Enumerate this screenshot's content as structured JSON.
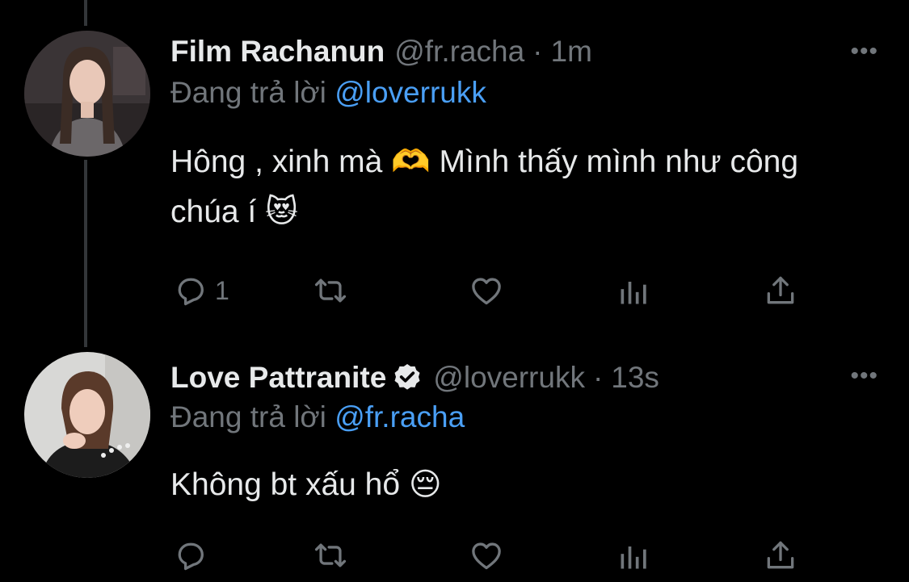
{
  "tweets": [
    {
      "name": "Film Rachanun",
      "handle": "@fr.racha",
      "sep": "·",
      "time": "1m",
      "reply_prefix": "Đang trả lời",
      "reply_to": "@loverrukk",
      "text_line1": "Hông , xinh mà 🫶  Mình thấy mình như công",
      "text_line2": "chúa í 😻",
      "reply_count": "1",
      "more": "•••"
    },
    {
      "name": "Love Pattranite",
      "handle": "@loverrukk",
      "sep": "·",
      "time": "13s",
      "reply_prefix": "Đang trả lời",
      "reply_to": "@fr.racha",
      "text_line1": "Không bt xấu hổ 😔",
      "reply_count": "",
      "more": "•••"
    }
  ],
  "colors": {
    "background": "#000000",
    "text": "#e7e9ea",
    "muted": "#71767b",
    "link": "#4a9ff5",
    "thread_line": "#333639"
  },
  "icons": [
    "reply-icon",
    "retweet-icon",
    "like-icon",
    "analytics-icon",
    "share-icon",
    "verified-badge-icon",
    "more-icon"
  ]
}
